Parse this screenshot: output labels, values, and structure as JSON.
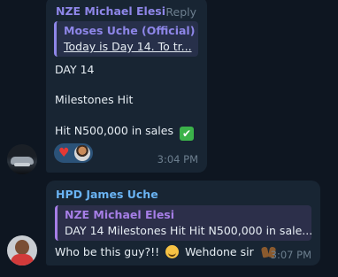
{
  "messages": [
    {
      "sender": "NZE Michael Elesi",
      "reply_action": "Reply",
      "quote": {
        "name": "Moses Uche (Official)",
        "text": "Today is Day 14.  To tr..."
      },
      "lines": [
        "DAY 14",
        "Milestones Hit",
        "Hit N500,000 in sales"
      ],
      "check_emoji": "✔",
      "reaction_heart": "♥",
      "time": "3:04 PM"
    },
    {
      "sender": "HPD James Uche",
      "quote": {
        "name": "NZE Michael Elesi",
        "text": "DAY 14  Milestones Hit  Hit N500,000 in sale..."
      },
      "text_before": "Who be this guy?!!",
      "text_after": "Wehdone sir",
      "time": "3:07 PM"
    }
  ],
  "colors": {
    "background": "#0e1621",
    "bubble": "#182533",
    "sender1": "#8e86e8",
    "sender2": "#6ab3f3",
    "reaction_pill": "#2b5278",
    "check": "#3bb24a"
  },
  "icons": {
    "check": "check-mark-icon",
    "heart": "heart-icon",
    "grinning_sweat": "grinning-sweat-emoji-icon",
    "raising_hands": "raising-hands-emoji-icon"
  }
}
